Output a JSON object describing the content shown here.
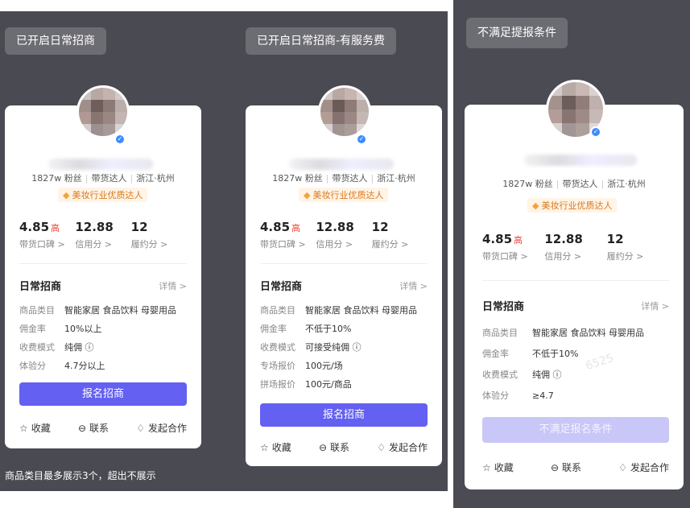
{
  "panels": [
    {
      "tag": "已开启日常招商",
      "fans": "1827w 粉丝",
      "role": "带货达人",
      "location": "浙江·杭州",
      "badge": "美妆行业优质达人",
      "stats": [
        {
          "value": "4.85",
          "hi": "高",
          "label": "带货口碑 >"
        },
        {
          "value": "12.88",
          "hi": "",
          "label": "信用分 >"
        },
        {
          "value": "12",
          "hi": "",
          "label": "履约分 >"
        }
      ],
      "section_title": "日常招商",
      "detail": "详情 >",
      "rows": [
        {
          "k": "商品类目",
          "v": "智能家居  食品饮料  母婴用品"
        },
        {
          "k": "佣金率",
          "v": "10%以上"
        },
        {
          "k": "收费模式",
          "v": "纯佣 ⓘ"
        },
        {
          "k": "体验分",
          "v": "4.7分以上"
        }
      ],
      "cta": "报名招商",
      "actions": {
        "fav": "收藏",
        "contact": "联系",
        "coop": "发起合作"
      },
      "footnote": "商品类目最多展示3个，超出不展示"
    },
    {
      "tag": "已开启日常招商-有服务费",
      "fans": "1827w 粉丝",
      "role": "带货达人",
      "location": "浙江·杭州",
      "badge": "美妆行业优质达人",
      "stats": [
        {
          "value": "4.85",
          "hi": "高",
          "label": "带货口碑 >"
        },
        {
          "value": "12.88",
          "hi": "",
          "label": "信用分 >"
        },
        {
          "value": "12",
          "hi": "",
          "label": "履约分 >"
        }
      ],
      "section_title": "日常招商",
      "detail": "详情 >",
      "rows": [
        {
          "k": "商品类目",
          "v": "智能家居  食品饮料  母婴用品"
        },
        {
          "k": "佣金率",
          "v": "不低于10%"
        },
        {
          "k": "收费模式",
          "v": "可接受纯佣 ⓘ"
        },
        {
          "k": "专场报价",
          "v": "100元/场"
        },
        {
          "k": "拼场报价",
          "v": "100元/商品"
        }
      ],
      "cta": "报名招商",
      "actions": {
        "fav": "收藏",
        "contact": "联系",
        "coop": "发起合作"
      }
    },
    {
      "tag": "不满足提报条件",
      "fans": "1827w 粉丝",
      "role": "带货达人",
      "location": "浙江·杭州",
      "badge": "美妆行业优质达人",
      "stats": [
        {
          "value": "4.85",
          "hi": "高",
          "label": "带货口碑 >"
        },
        {
          "value": "12.88",
          "hi": "",
          "label": "信用分 >"
        },
        {
          "value": "12",
          "hi": "",
          "label": "履约分 >"
        }
      ],
      "section_title": "日常招商",
      "detail": "详情 >",
      "rows": [
        {
          "k": "商品类目",
          "v": "智能家居  食品饮料  母婴用品"
        },
        {
          "k": "佣金率",
          "v": "不低于10%"
        },
        {
          "k": "收费模式",
          "v": "纯佣 ⓘ"
        },
        {
          "k": "体验分",
          "v": "≥4.7"
        }
      ],
      "cta": "不满足报名条件",
      "actions": {
        "fav": "收藏",
        "contact": "联系",
        "coop": "发起合作"
      },
      "watermark": "6525"
    }
  ],
  "colors": {
    "accent": "#6360f2",
    "accent_disabled": "#c9c6f8",
    "highlight": "#f04438",
    "badge_text": "#d97a1e",
    "panel_bg": "#4a4a52"
  },
  "icons": {
    "gem": "gem-icon",
    "star": "star-icon",
    "chat": "chat-icon",
    "handshake": "handshake-icon",
    "verified": "verified-check-icon"
  }
}
